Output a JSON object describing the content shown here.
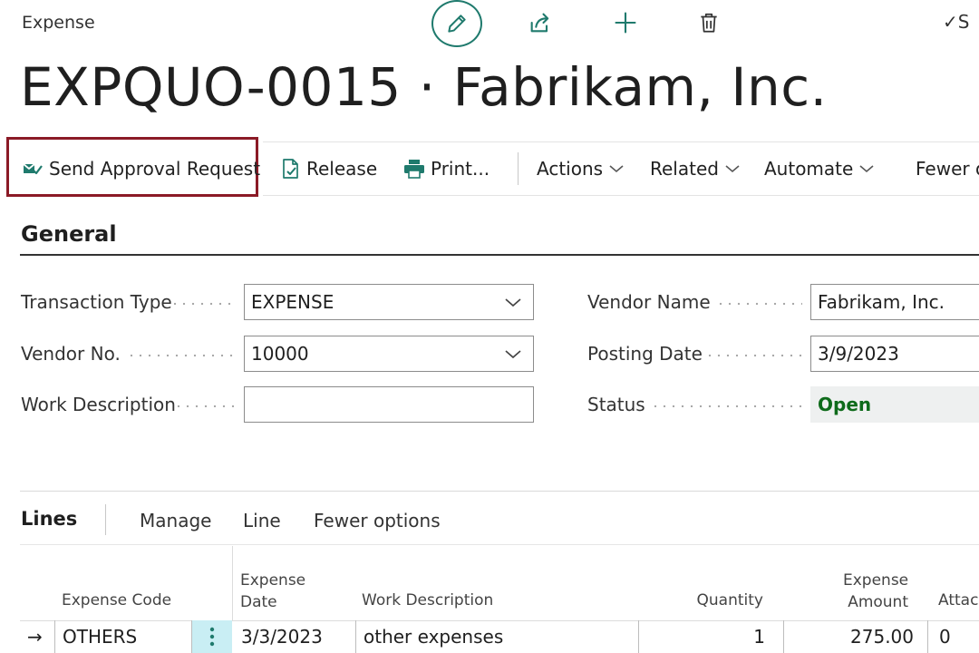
{
  "header": {
    "page_type": "Expense",
    "title": "EXPQUO-0015 · Fabrikam, Inc.",
    "saved_label": "✓S"
  },
  "icons": {
    "edit": "pencil-icon",
    "share": "share-icon",
    "new": "plus-icon",
    "delete": "trash-icon"
  },
  "actionbar": {
    "send_approval": "Send Approval Request",
    "release": "Release",
    "print": "Print...",
    "actions": "Actions",
    "related": "Related",
    "automate": "Automate",
    "fewer": "Fewer o"
  },
  "general": {
    "section_title": "General",
    "transaction_type_label": "Transaction Type",
    "transaction_type_value": "EXPENSE",
    "vendor_no_label": "Vendor No.",
    "vendor_no_value": "10000",
    "work_description_label": "Work Description",
    "work_description_value": "",
    "vendor_name_label": "Vendor Name",
    "vendor_name_value": "Fabrikam, Inc.",
    "posting_date_label": "Posting Date",
    "posting_date_value": "3/9/2023",
    "status_label": "Status",
    "status_value": "Open"
  },
  "lines": {
    "title": "Lines",
    "menu": [
      "Manage",
      "Line",
      "Fewer options"
    ],
    "columns": {
      "expense_code": "Expense Code",
      "expense_date_1": "Expense",
      "expense_date_2": "Date",
      "work_description": "Work Description",
      "quantity": "Quantity",
      "expense_amount_1": "Expense",
      "expense_amount_2": "Amount",
      "attach": "Attach"
    },
    "rows": [
      {
        "arrow": "→",
        "expense_code": "OTHERS",
        "expense_date": "3/3/2023",
        "work_description": "other expenses",
        "quantity": "1",
        "expense_amount": "275.00",
        "attach": "0"
      }
    ]
  },
  "colors": {
    "accent": "#1f7a6d",
    "highlight": "#8b1a26",
    "status_open": "#0e6b1b",
    "row_menu_bg": "#c9eef4"
  }
}
